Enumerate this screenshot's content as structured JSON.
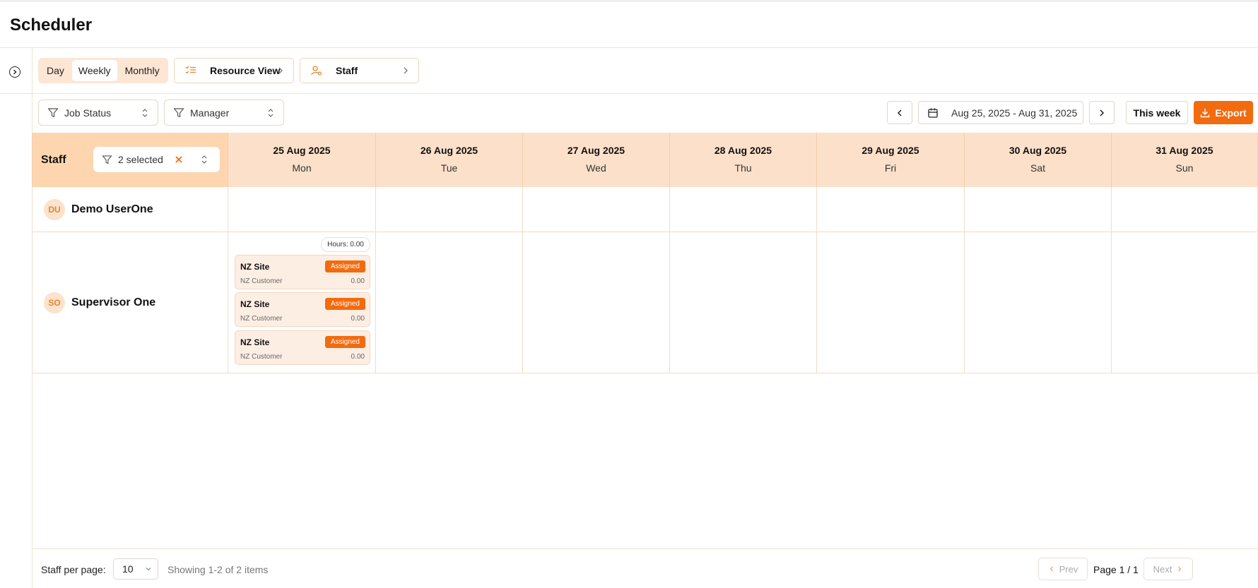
{
  "app": {
    "title": "Scheduler"
  },
  "toolbar": {
    "views": [
      "Day",
      "Weekly",
      "Monthly"
    ],
    "active_view": "Weekly",
    "resource_view_label": "Resource View",
    "staff_label": "Staff"
  },
  "filters": {
    "job_status_label": "Job Status",
    "manager_label": "Manager"
  },
  "range": {
    "label": "Aug 25, 2025 - Aug 31, 2025",
    "this_week_label": "This week",
    "export_label": "Export"
  },
  "grid": {
    "staff_header": "Staff",
    "selected_label": "2 selected",
    "days": [
      {
        "date": "25 Aug 2025",
        "weekday": "Mon"
      },
      {
        "date": "26 Aug 2025",
        "weekday": "Tue"
      },
      {
        "date": "27 Aug 2025",
        "weekday": "Wed"
      },
      {
        "date": "28 Aug 2025",
        "weekday": "Thu"
      },
      {
        "date": "29 Aug 2025",
        "weekday": "Fri"
      },
      {
        "date": "30 Aug 2025",
        "weekday": "Sat"
      },
      {
        "date": "31 Aug 2025",
        "weekday": "Sun"
      }
    ],
    "rows": [
      {
        "initials": "DU",
        "name": "Demo UserOne"
      },
      {
        "initials": "SO",
        "name": "Supervisor One"
      }
    ],
    "hours_label": "Hours: 0.00",
    "jobs": [
      {
        "site": "NZ Site",
        "status": "Assigned",
        "customer": "NZ Customer",
        "amount": "0.00"
      },
      {
        "site": "NZ Site",
        "status": "Assigned",
        "customer": "NZ Customer",
        "amount": "0.00"
      },
      {
        "site": "NZ Site",
        "status": "Assigned",
        "customer": "NZ Customer",
        "amount": "0.00"
      }
    ]
  },
  "footer": {
    "per_page_label": "Staff per page:",
    "per_page_value": "10",
    "showing": "Showing 1-2 of 2 items",
    "prev": "Prev",
    "page": "Page 1 / 1",
    "next": "Next"
  },
  "colors": {
    "accent": "#f26b0f",
    "header_bg": "#fde0c9",
    "staff_header_bg": "#fdd6b0"
  }
}
